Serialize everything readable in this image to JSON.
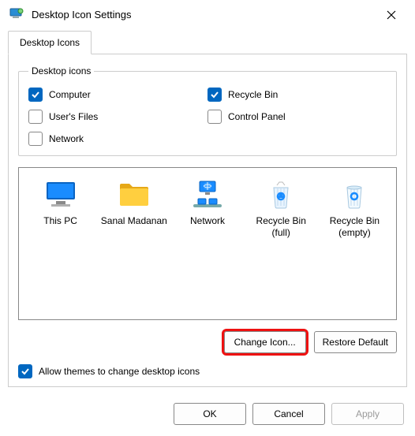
{
  "titlebar": {
    "title": "Desktop Icon Settings"
  },
  "tabs": {
    "icons": "Desktop Icons"
  },
  "group": {
    "legend": "Desktop icons"
  },
  "checks": {
    "computer": "Computer",
    "recyclebin": "Recycle Bin",
    "userfiles": "User's Files",
    "controlpanel": "Control Panel",
    "network": "Network"
  },
  "preview": {
    "thispc": "This PC",
    "userfolder": "Sanal Madanan",
    "network": "Network",
    "recyclefull": "Recycle Bin (full)",
    "recycleempty": "Recycle Bin (empty)"
  },
  "buttons": {
    "change": "Change Icon...",
    "restore": "Restore Default",
    "ok": "OK",
    "cancel": "Cancel",
    "apply": "Apply"
  },
  "allow": "Allow themes to change desktop icons"
}
